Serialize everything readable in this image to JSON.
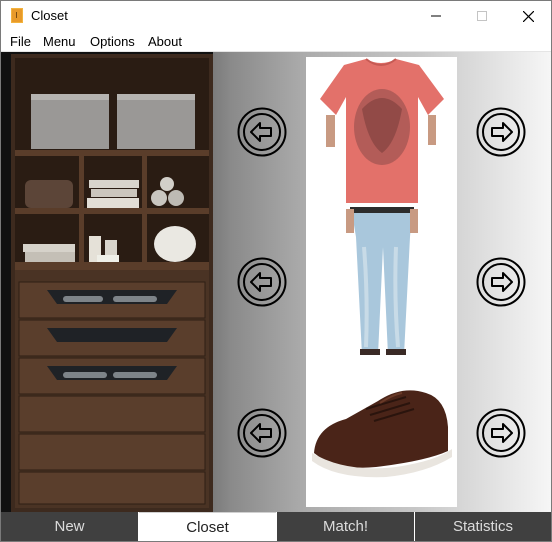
{
  "window": {
    "title": "Closet",
    "icon": "closet-app-icon"
  },
  "controls": {
    "minimize_icon": "minimize-icon",
    "maximize_icon": "maximize-icon",
    "close_icon": "close-icon"
  },
  "menu": {
    "items": [
      "File",
      "Menu",
      "Options",
      "About"
    ]
  },
  "slots": [
    {
      "name": "top",
      "item": "red graphic t-shirt",
      "left_icon": "arrow-left-icon",
      "right_icon": "arrow-right-icon"
    },
    {
      "name": "bottom",
      "item": "light blue jeans",
      "left_icon": "arrow-left-icon",
      "right_icon": "arrow-right-icon"
    },
    {
      "name": "shoes",
      "item": "brown lace-up sneaker",
      "left_icon": "arrow-left-icon",
      "right_icon": "arrow-right-icon"
    }
  ],
  "tabs": [
    {
      "label": "New",
      "active": false
    },
    {
      "label": "Closet",
      "active": true
    },
    {
      "label": "Match!",
      "active": false
    },
    {
      "label": "Statistics",
      "active": false
    }
  ],
  "colors": {
    "tab_bg": "#404040",
    "tab_active_bg": "#ffffff",
    "wood": "#4a3324",
    "shirt": "#e0706a",
    "jeans": "#a9c7dc",
    "shoe": "#4a2418"
  }
}
